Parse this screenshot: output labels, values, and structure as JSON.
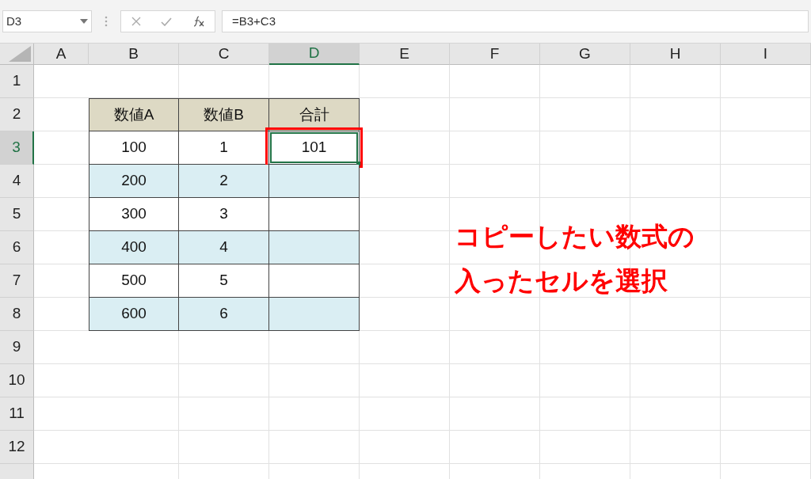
{
  "name_box": "D3",
  "formula_bar": {
    "value": "=B3+C3"
  },
  "columns": [
    {
      "label": "A",
      "selected": false
    },
    {
      "label": "B",
      "selected": false
    },
    {
      "label": "C",
      "selected": false
    },
    {
      "label": "D",
      "selected": true
    },
    {
      "label": "E",
      "selected": false
    },
    {
      "label": "F",
      "selected": false
    },
    {
      "label": "G",
      "selected": false
    },
    {
      "label": "H",
      "selected": false
    },
    {
      "label": "I",
      "selected": false
    }
  ],
  "rows": [
    {
      "label": "1",
      "selected": false
    },
    {
      "label": "2",
      "selected": false
    },
    {
      "label": "3",
      "selected": true
    },
    {
      "label": "4",
      "selected": false
    },
    {
      "label": "5",
      "selected": false
    },
    {
      "label": "6",
      "selected": false
    },
    {
      "label": "7",
      "selected": false
    },
    {
      "label": "8",
      "selected": false
    },
    {
      "label": "9",
      "selected": false
    },
    {
      "label": "10",
      "selected": false
    },
    {
      "label": "11",
      "selected": false
    },
    {
      "label": "12",
      "selected": false
    }
  ],
  "table": {
    "header": [
      "数値A",
      "数値B",
      "合計"
    ],
    "rows": [
      {
        "shaded": false,
        "cells": [
          {
            "text": "100",
            "selected": false
          },
          {
            "text": "1",
            "selected": false
          },
          {
            "text": "101",
            "selected": true
          }
        ]
      },
      {
        "shaded": true,
        "cells": [
          {
            "text": "200",
            "selected": false
          },
          {
            "text": "2",
            "selected": false
          },
          {
            "text": "",
            "selected": false
          }
        ]
      },
      {
        "shaded": false,
        "cells": [
          {
            "text": "300",
            "selected": false
          },
          {
            "text": "3",
            "selected": false
          },
          {
            "text": "",
            "selected": false
          }
        ]
      },
      {
        "shaded": true,
        "cells": [
          {
            "text": "400",
            "selected": false
          },
          {
            "text": "4",
            "selected": false
          },
          {
            "text": "",
            "selected": false
          }
        ]
      },
      {
        "shaded": false,
        "cells": [
          {
            "text": "500",
            "selected": false
          },
          {
            "text": "5",
            "selected": false
          },
          {
            "text": "",
            "selected": false
          }
        ]
      },
      {
        "shaded": true,
        "cells": [
          {
            "text": "600",
            "selected": false
          },
          {
            "text": "6",
            "selected": false
          },
          {
            "text": "",
            "selected": false
          }
        ]
      }
    ]
  },
  "annotation": [
    "コピーしたい数式の",
    "入ったセルを選択"
  ]
}
